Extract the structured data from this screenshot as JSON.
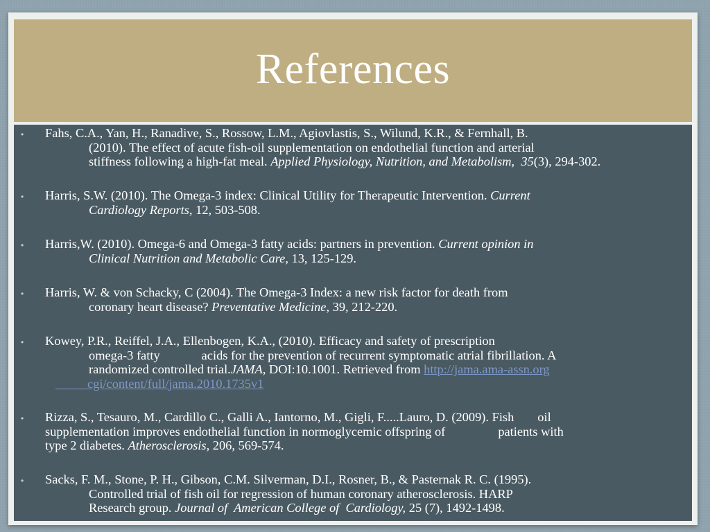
{
  "slide": {
    "title": "References",
    "refs": [
      {
        "l1": "Fahs, C.A., Yan, H., Ranadive, S., Rossow, L.M., Agiovlastis, S., Wilund, K.R., & Fernhall, B.",
        "l2": "(2010). The effect of acute fish-oil supplementation on endothelial function and arterial",
        "l3_a": "stiffness following a high-fat meal. ",
        "l3_journal": "Applied Physiology, Nutrition, and Metabolism",
        "l3_b": ",  ",
        "l3_vol": "35",
        "l3_c": "(3), 294-302."
      },
      {
        "l1_a": "Harris, S.W. (2010). The Omega-3 index: Clinical Utility for Therapeutic Intervention. ",
        "l1_journal": "Current",
        "l2_journal": "Cardiology Reports",
        "l2_b": ", 12, 503-508."
      },
      {
        "l1_a": "Harris,W. (2010). Omega-6 and Omega-3 fatty acids: partners in prevention. ",
        "l1_journal": "Current opinion in",
        "l2_journal": "Clinical Nutrition and Metabolic Care,",
        "l2_b": " 13, 125-129."
      },
      {
        "l1": "Harris, W. & von Schacky, C (2004). The Omega-3 Index: a new risk factor for death from",
        "l2_a": "coronary heart disease? ",
        "l2_journal": "Preventative Medicine",
        "l2_b": ", 39, 212-220."
      },
      {
        "l1": "Kowey, P.R., Reiffel, J.A., Ellenbogen, K.A., (2010). Efficacy and safety of prescription",
        "l2_a": "omega-3 fatty",
        "l2_b": "acids for the prevention of recurrent symptomatic atrial fibrillation. A",
        "l3_a": "randomized controlled trial.",
        "l3_journal": "JAMA",
        "l3_b": ", DOI:10.1001. Retrieved from ",
        "l3_link": "http://jama.ama-assn.org",
        "l4_link": "cgi/content/full/jama.2010.1735v1"
      },
      {
        "l1_a": "Rizza, S., Tesauro, M., Cardillo C., Galli A., Iantorno, M., Gigli, F.....Lauro, D. (2009). Fish",
        "l1_b": "oil",
        "l2_a": "supplementation improves endothelial function in normoglycemic offspring of",
        "l2_b": "patients with",
        "l3_a": "type 2 diabetes. ",
        "l3_journal": "Atherosclerosis,",
        "l3_b": " 206, 569-574."
      },
      {
        "l1": "Sacks, F. M., Stone, P. H., Gibson, C.M. Silverman, D.I., Rosner, B., & Pasternak R. C. (1995).",
        "l2": "Controlled trial of fish oil for regression of human coronary atherosclerosis. HARP",
        "l3_a": "Research group. ",
        "l3_journal": "Journal of  American College of  Cardiology,",
        "l3_b": " 25 (7), 1492-1498."
      }
    ]
  },
  "colors": {
    "title_band": "#bfae81",
    "content_bg": "#4a5a62",
    "link": "#7d98c9"
  }
}
